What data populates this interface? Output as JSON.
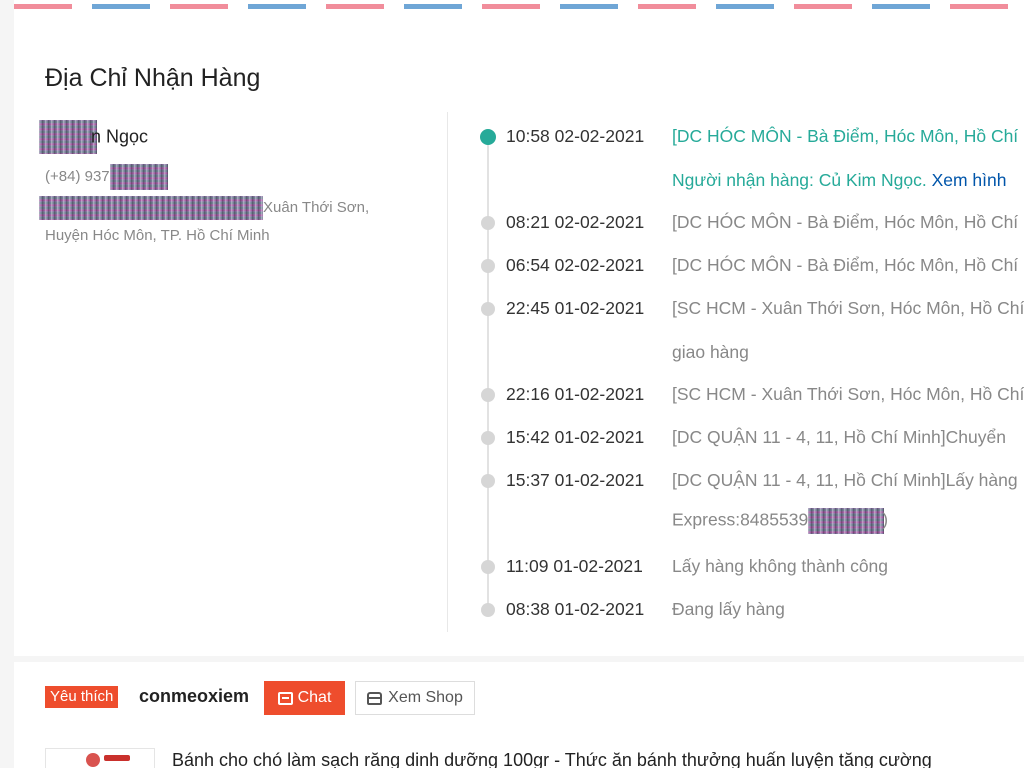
{
  "address": {
    "title": "Địa Chỉ Nhận Hàng",
    "name_visible": "n Ngọc",
    "phone_prefix": "(+84) 937",
    "address_line1_visible": "Xuân Thới Sơn,",
    "address_line2": "Huyện Hóc Môn, TP. Hồ Chí Minh"
  },
  "tracking": {
    "events": [
      {
        "time": "10:58 02-02-2021",
        "desc": "[DC HÓC MÔN - Bà Điểm, Hóc Môn, Hồ Chí",
        "active": true
      },
      {
        "time": "08:21 02-02-2021",
        "desc": "[DC HÓC MÔN - Bà Điểm, Hóc Môn, Hồ Chí"
      },
      {
        "time": "06:54 02-02-2021",
        "desc": "[DC HÓC MÔN - Bà Điểm, Hóc Môn, Hồ Chí"
      },
      {
        "time": "22:45 01-02-2021",
        "desc": "[SC HCM - Xuân Thới Sơn, Hóc Môn, Hồ Chí"
      },
      {
        "time": "22:16 01-02-2021",
        "desc": "[SC HCM - Xuân Thới Sơn, Hóc Môn, Hồ Chí"
      },
      {
        "time": "15:42 01-02-2021",
        "desc": "[DC QUẬN 11 - 4, 11, Hồ Chí Minh]Chuyển"
      },
      {
        "time": "15:37 01-02-2021",
        "desc": "[DC QUẬN 11 - 4, 11, Hồ Chí Minh]Lấy hàng"
      },
      {
        "time": "11:09 01-02-2021",
        "desc": "Lấy hàng không thành công"
      },
      {
        "time": "08:38 01-02-2021",
        "desc": "Đang lấy hàng"
      }
    ],
    "event0_cont_text": "Người nhận hàng: Củ Kim Ngọc. ",
    "event0_cont_link": "Xem hình",
    "event3_cont": "giao hàng",
    "event6_cont_prefix": "Express:8485539",
    "event6_cont_suffix": ")"
  },
  "shop": {
    "badge": "Yêu thích",
    "name": "conmeoxiem",
    "chat_label": "Chat",
    "view_shop_label": "Xem Shop"
  },
  "product": {
    "title": "Bánh cho chó làm sạch răng dinh dưỡng 100gr - Thức ăn bánh thưởng huấn luyện tăng cường"
  },
  "colors": {
    "accent": "#ee4d2d",
    "teal": "#26aa99",
    "link": "#0055aa"
  },
  "icons": {
    "chat": "chat-icon",
    "shop": "shop-icon"
  }
}
